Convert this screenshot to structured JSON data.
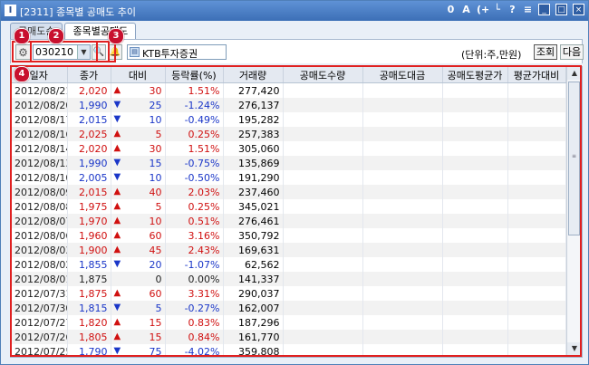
{
  "window": {
    "app_icon": "I",
    "title": "[2311] 종목별 공매도 추이",
    "tools": [
      "0",
      "A",
      "(+",
      "└",
      "?",
      "≡"
    ],
    "controls": [
      "_",
      "□",
      "×"
    ]
  },
  "tabs": [
    {
      "label": "공매도순"
    },
    {
      "label": "종목별공매도"
    }
  ],
  "toolbar": {
    "stock_code": "030210",
    "stock_name": "KTB투자증권",
    "unit_label": "(단위:주,만원)",
    "query_label": "조회",
    "next_label": "다음"
  },
  "badges": [
    "1",
    "2",
    "3",
    "4"
  ],
  "table": {
    "columns": [
      "일자",
      "종가",
      "대비",
      "등락률(%)",
      "거래량",
      "공매도수량",
      "공매도대금",
      "공매도평균가",
      "평균가대비"
    ],
    "rows": [
      {
        "date": "2012/08/21",
        "close": "2,020",
        "dir": "up",
        "sym": "▲",
        "change": "30",
        "rate": "1.51%",
        "volume": "277,420"
      },
      {
        "date": "2012/08/20",
        "close": "1,990",
        "dir": "down",
        "sym": "▼",
        "change": "25",
        "rate": "-1.24%",
        "volume": "276,137"
      },
      {
        "date": "2012/08/17",
        "close": "2,015",
        "dir": "down",
        "sym": "▼",
        "change": "10",
        "rate": "-0.49%",
        "volume": "195,282"
      },
      {
        "date": "2012/08/16",
        "close": "2,025",
        "dir": "up",
        "sym": "▲",
        "change": "5",
        "rate": "0.25%",
        "volume": "257,383"
      },
      {
        "date": "2012/08/14",
        "close": "2,020",
        "dir": "up",
        "sym": "▲",
        "change": "30",
        "rate": "1.51%",
        "volume": "305,060"
      },
      {
        "date": "2012/08/13",
        "close": "1,990",
        "dir": "down",
        "sym": "▼",
        "change": "15",
        "rate": "-0.75%",
        "volume": "135,869"
      },
      {
        "date": "2012/08/10",
        "close": "2,005",
        "dir": "down",
        "sym": "▼",
        "change": "10",
        "rate": "-0.50%",
        "volume": "191,290"
      },
      {
        "date": "2012/08/09",
        "close": "2,015",
        "dir": "up",
        "sym": "▲",
        "change": "40",
        "rate": "2.03%",
        "volume": "237,460"
      },
      {
        "date": "2012/08/08",
        "close": "1,975",
        "dir": "up",
        "sym": "▲",
        "change": "5",
        "rate": "0.25%",
        "volume": "345,021"
      },
      {
        "date": "2012/08/07",
        "close": "1,970",
        "dir": "up",
        "sym": "▲",
        "change": "10",
        "rate": "0.51%",
        "volume": "276,461"
      },
      {
        "date": "2012/08/06",
        "close": "1,960",
        "dir": "up",
        "sym": "▲",
        "change": "60",
        "rate": "3.16%",
        "volume": "350,792"
      },
      {
        "date": "2012/08/03",
        "close": "1,900",
        "dir": "up",
        "sym": "▲",
        "change": "45",
        "rate": "2.43%",
        "volume": "169,631"
      },
      {
        "date": "2012/08/02",
        "close": "1,855",
        "dir": "down",
        "sym": "▼",
        "change": "20",
        "rate": "-1.07%",
        "volume": "62,562"
      },
      {
        "date": "2012/08/01",
        "close": "1,875",
        "dir": "flat",
        "sym": "",
        "change": "0",
        "rate": "0.00%",
        "volume": "141,337"
      },
      {
        "date": "2012/07/31",
        "close": "1,875",
        "dir": "up",
        "sym": "▲",
        "change": "60",
        "rate": "3.31%",
        "volume": "290,037"
      },
      {
        "date": "2012/07/30",
        "close": "1,815",
        "dir": "down",
        "sym": "▼",
        "change": "5",
        "rate": "-0.27%",
        "volume": "162,007"
      },
      {
        "date": "2012/07/27",
        "close": "1,820",
        "dir": "up",
        "sym": "▲",
        "change": "15",
        "rate": "0.83%",
        "volume": "187,296"
      },
      {
        "date": "2012/07/26",
        "close": "1,805",
        "dir": "up",
        "sym": "▲",
        "change": "15",
        "rate": "0.84%",
        "volume": "161,770"
      },
      {
        "date": "2012/07/25",
        "close": "1,790",
        "dir": "down",
        "sym": "▼",
        "change": "75",
        "rate": "-4.02%",
        "volume": "359,808"
      }
    ]
  },
  "scrollbar": {
    "up": "▲",
    "down": "▼",
    "grip": "≡"
  },
  "colors": {
    "up": "#d01010",
    "down": "#1a36c8",
    "badge": "#c8102e",
    "highlight": "#e02020"
  }
}
